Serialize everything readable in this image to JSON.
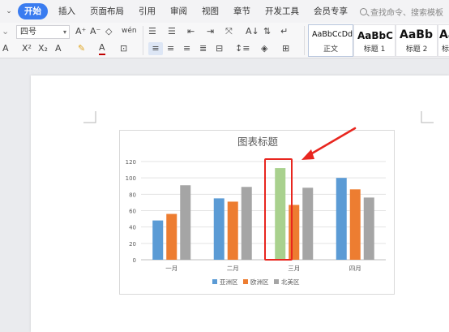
{
  "menu": {
    "caret": "⌄",
    "tabs": [
      "开始",
      "插入",
      "页面布局",
      "引用",
      "审阅",
      "视图",
      "章节",
      "开发工具",
      "会员专享"
    ],
    "active_tab": "开始",
    "search_placeholder": "查找命令、搜索模板"
  },
  "ribbon": {
    "font_size": "四号",
    "style_gallery": [
      {
        "sample": "AaBbCcDd",
        "name": "正文"
      },
      {
        "sample": "AaBbC",
        "name": "标题 1"
      },
      {
        "sample": "AaBb",
        "name": "标题 2"
      },
      {
        "sample": "Aa",
        "name": "标"
      }
    ]
  },
  "colors": {
    "accent": "#3a7cf0",
    "series_asia": "#5b9bd5",
    "series_europe": "#ed7d31",
    "series_namerica": "#a5a5a5",
    "highlight_bar": "#a9d18e",
    "annotation": "#e8261f"
  },
  "chart_data": {
    "type": "bar",
    "title": "图表标题",
    "categories": [
      "一月",
      "二月",
      "三月",
      "四月"
    ],
    "series": [
      {
        "name": "亚洲区",
        "values": [
          48,
          75,
          112,
          100
        ]
      },
      {
        "name": "欧洲区",
        "values": [
          56,
          71,
          67,
          86
        ]
      },
      {
        "name": "北美区",
        "values": [
          91,
          89,
          88,
          76
        ]
      }
    ],
    "highlight": {
      "series_index": 0,
      "category_index": 2
    },
    "ylim": [
      0,
      120
    ],
    "yticks": [
      0,
      20,
      40,
      60,
      80,
      100,
      120
    ],
    "grid": true,
    "legend": "bottom",
    "xlabel": "",
    "ylabel": ""
  }
}
